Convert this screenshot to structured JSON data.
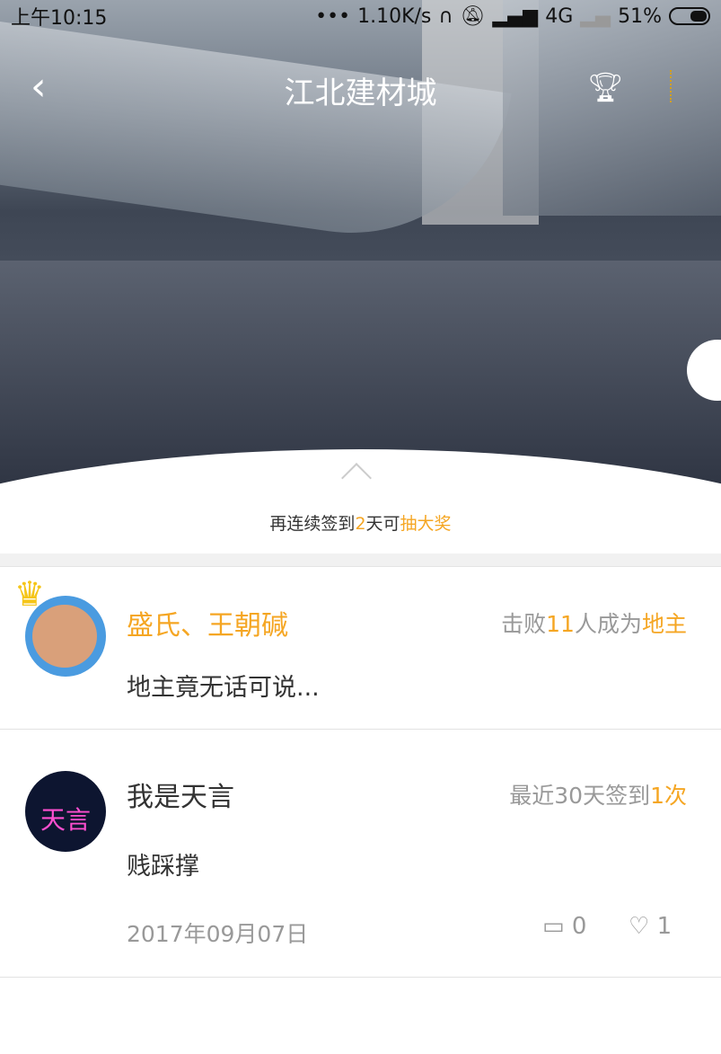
{
  "status": {
    "time": "上午10:15",
    "dots": "•••",
    "speed": "1.10K/s",
    "network": "4G",
    "battery": "51%"
  },
  "nav": {
    "title": "江北建材城"
  },
  "tip": {
    "p1": "再连续签到",
    "days": "2",
    "p2": "天可",
    "prize": "抽大奖"
  },
  "landlord": {
    "name": "盛氏、王朝碱",
    "meta_pre": "击败",
    "count": "11",
    "meta_mid": "人成为",
    "meta_role": "地主",
    "text": "地主竟无话可说..."
  },
  "post": {
    "name": "我是天言",
    "meta_pre": "最近30天签到",
    "count": "1次",
    "avatar_text": "天言",
    "text": "贱踩撑",
    "date": "2017年09月07日",
    "comments": "0",
    "likes": "1"
  },
  "colors": {
    "accent": "#f5a623"
  }
}
